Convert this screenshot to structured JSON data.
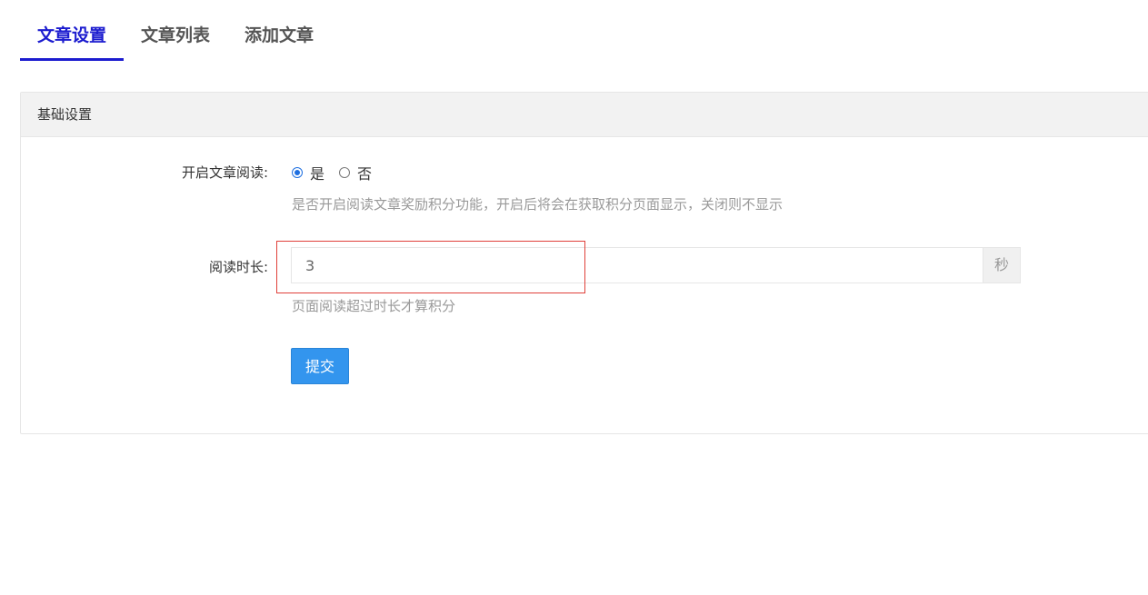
{
  "tabs": [
    {
      "label": "文章设置",
      "active": true
    },
    {
      "label": "文章列表",
      "active": false
    },
    {
      "label": "添加文章",
      "active": false
    }
  ],
  "panel": {
    "title": "基础设置",
    "reading_toggle": {
      "label": "开启文章阅读:",
      "options": [
        "是",
        "否"
      ],
      "selected": "是",
      "hint": "是否开启阅读文章奖励积分功能，开启后将会在获取积分页面显示，关闭则不显示"
    },
    "reading_duration": {
      "label": "阅读时长:",
      "value": "3",
      "suffix": "秒",
      "hint": "页面阅读超过时长才算积分"
    },
    "submit_label": "提交"
  },
  "colors": {
    "accent": "#1c1ccf",
    "button": "#3395ee",
    "highlight": "#e0403a"
  }
}
